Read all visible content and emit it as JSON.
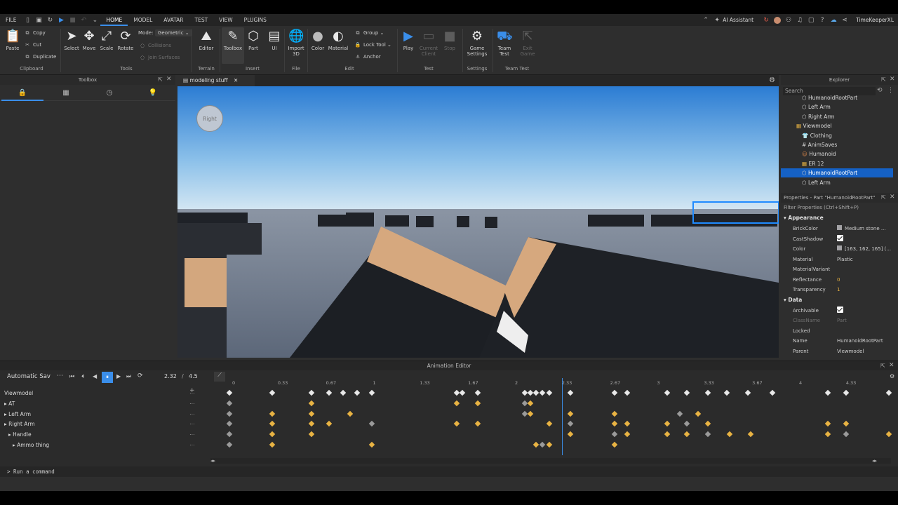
{
  "menubar": {
    "file": "FILE",
    "tabs": [
      "HOME",
      "MODEL",
      "AVATAR",
      "TEST",
      "VIEW",
      "PLUGINS"
    ],
    "ai": "AI Assistant",
    "user": "TimeKeeperXL"
  },
  "ribbon": {
    "paste": "Paste",
    "copy": "Copy",
    "cut": "Cut",
    "duplicate": "Duplicate",
    "clipboard": "Clipboard",
    "select": "Select",
    "move": "Move",
    "scale": "Scale",
    "rotate": "Rotate",
    "mode_label": "Mode:",
    "mode_value": "Geometric",
    "collisions": "Collisions",
    "join_surfaces": "Join Surfaces",
    "tools": "Tools",
    "editor": "Editor",
    "terrain": "Terrain",
    "toolbox": "Toolbox",
    "part": "Part",
    "ui": "UI",
    "insert": "Insert",
    "import3d": "Import 3D",
    "file": "File",
    "color": "Color",
    "material": "Material",
    "group": "Group",
    "lock_tool": "Lock Tool",
    "anchor": "Anchor",
    "edit": "Edit",
    "play": "Play",
    "current_client": "Current Client",
    "stop": "Stop",
    "test": "Test",
    "game_settings": "Game Settings",
    "settings": "Settings",
    "team_test": "Team Test",
    "exit_game": "Exit Game",
    "team_test_group": "Team Test"
  },
  "toolbox": {
    "title": "Toolbox"
  },
  "viewport": {
    "tab": "modeling stuff",
    "gizmo": "Right"
  },
  "explorer": {
    "title": "Explorer",
    "search": "Search",
    "items": [
      {
        "label": "HumanoidRootPart",
        "icon": "part",
        "depth": 3
      },
      {
        "label": "Left Arm",
        "icon": "part",
        "depth": 3
      },
      {
        "label": "Right Arm",
        "icon": "part",
        "depth": 3
      },
      {
        "label": "Viewmodel",
        "icon": "model",
        "depth": 2
      },
      {
        "label": "Clothing",
        "icon": "clothing",
        "depth": 3
      },
      {
        "label": "AnimSaves",
        "icon": "folder",
        "depth": 3
      },
      {
        "label": "Humanoid",
        "icon": "humanoid",
        "depth": 3
      },
      {
        "label": "ER 12",
        "icon": "model",
        "depth": 3
      },
      {
        "label": "HumanoidRootPart",
        "icon": "part",
        "depth": 3,
        "selected": true
      },
      {
        "label": "Left Arm",
        "icon": "part",
        "depth": 3
      }
    ]
  },
  "properties": {
    "title": "Properties - Part \"HumanoidRootPart\"",
    "filter": "Filter Properties (Ctrl+Shift+P)",
    "appearance": "Appearance",
    "data": "Data",
    "rows": [
      {
        "k": "BrickColor",
        "v": "Medium stone ...",
        "swatch": "#a3a2a5"
      },
      {
        "k": "CastShadow",
        "check": true
      },
      {
        "k": "Color",
        "v": "[163, 162, 165] (...",
        "swatch": "#a3a2a5"
      },
      {
        "k": "Material",
        "v": "Plastic"
      },
      {
        "k": "MaterialVariant",
        "v": ""
      },
      {
        "k": "Reflectance",
        "v": "0"
      },
      {
        "k": "Transparency",
        "v": "1"
      }
    ],
    "data_rows": [
      {
        "k": "Archivable",
        "check": true
      },
      {
        "k": "ClassName",
        "v": "Part",
        "dim": true
      },
      {
        "k": "Locked",
        "v": ""
      },
      {
        "k": "Name",
        "v": "HumanoidRootPart"
      },
      {
        "k": "Parent",
        "v": "Viewmodel"
      }
    ]
  },
  "anim": {
    "title": "Animation Editor",
    "save": "Automatic Sav",
    "time": "2.32",
    "slash": "/",
    "length": "4.5",
    "ticks": [
      "0",
      "0.33",
      "0.67",
      "1",
      "1.33",
      "1.67",
      "2",
      "2.33",
      "2.67",
      "3",
      "3.33",
      "3.67",
      "4",
      "4.33"
    ],
    "tracks": [
      "Viewmodel",
      "AT",
      "Left Arm",
      "Right Arm",
      "Handle",
      "Ammo thing"
    ],
    "playhead": 2.32,
    "keyframes": [
      [
        0,
        0.3,
        0.58,
        0.7,
        0.8,
        0.9,
        1.0,
        1.6,
        1.64,
        1.75,
        2.08,
        2.12,
        2.16,
        2.2,
        2.25,
        2.4,
        2.71,
        2.8,
        3.08,
        3.22,
        3.37,
        3.5,
        3.65,
        3.82,
        4.21,
        4.34,
        4.64,
        5.08
      ],
      [
        0,
        0.58,
        1.6,
        1.75,
        2.08,
        2.12
      ],
      [
        0,
        0.3,
        0.58,
        0.85,
        2.08,
        2.12,
        2.4,
        2.71,
        3.17,
        3.3
      ],
      [
        0,
        0.3,
        0.58,
        0.7,
        1.0,
        1.6,
        1.75,
        2.25,
        2.4,
        2.71,
        2.8,
        3.08,
        3.22,
        3.37,
        4.21,
        4.34,
        5.08
      ],
      [
        0,
        0.3,
        0.58,
        2.4,
        2.71,
        2.8,
        3.08,
        3.22,
        3.37,
        3.52,
        3.67,
        4.21,
        4.34,
        4.64,
        5.08
      ],
      [
        0,
        0.3,
        1.0,
        2.16,
        2.2,
        2.25,
        2.71
      ]
    ]
  },
  "command": {
    "placeholder": "Run a command"
  }
}
